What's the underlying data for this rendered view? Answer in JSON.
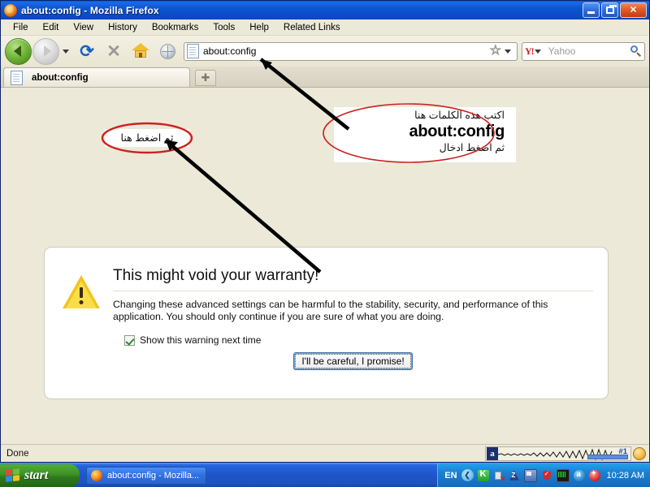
{
  "window": {
    "title": "about:config - Mozilla Firefox",
    "icon": "firefox-icon",
    "minimize_label": "Minimize",
    "restore_label": "Restore",
    "close_label": "Close"
  },
  "menubar": {
    "items": [
      {
        "label": "File"
      },
      {
        "label": "Edit"
      },
      {
        "label": "View"
      },
      {
        "label": "History"
      },
      {
        "label": "Bookmarks"
      },
      {
        "label": "Tools"
      },
      {
        "label": "Help"
      },
      {
        "label": "Related Links"
      }
    ]
  },
  "toolbar": {
    "back_label": "Back",
    "forward_label": "Forward",
    "dropdown_label": "Recent pages",
    "reload_glyph": "⟳",
    "stop_glyph": "✕",
    "home_label": "Home",
    "globe_label": "Web",
    "url_value": "about:config",
    "star_glyph": "☆",
    "search_engine": "Yahoo!",
    "search_engine_glyph": "Y!",
    "search_placeholder": "Yahoo"
  },
  "tabbar": {
    "tabs": [
      {
        "label": "about:config",
        "icon": "page-icon"
      }
    ],
    "newtab_glyph": "✚"
  },
  "page": {
    "warning": {
      "heading": "This might void your warranty!",
      "body": "Changing these advanced settings can be harmful to the stability, security, and performance of this application. You should only continue if you are sure of what you are doing.",
      "checkbox_label": "Show this warning next time",
      "checkbox_checked": true,
      "button_label": "I'll be careful, I promise!"
    }
  },
  "annotations": {
    "right_callout": {
      "line1": "اكتب هذه الكلمات هنا",
      "line2": "about:config",
      "line3": "ثم اضغط ادخال"
    },
    "left_callout": {
      "line1": "ثم اضغط هنا"
    },
    "ellipse_color": "#cc2222",
    "arrow_color": "#000000"
  },
  "statusbar": {
    "status": "Done",
    "widget_badge": "a",
    "widget_label": "#1",
    "smiley_icon": "smiley-icon"
  },
  "taskbar": {
    "start_label": "start",
    "items": [
      {
        "label": "about:config - Mozilla...",
        "icon": "firefox-icon"
      }
    ],
    "tray": {
      "language": "EN",
      "chevron_glyph": "❮",
      "icons": [
        "kaspersky-icon",
        "spray-icon",
        "zonealarm-icon",
        "network-icon",
        "shield-icon",
        "monitor-icon",
        "blue-a-icon",
        "red-star-icon"
      ],
      "clock": "10:28 AM"
    }
  }
}
